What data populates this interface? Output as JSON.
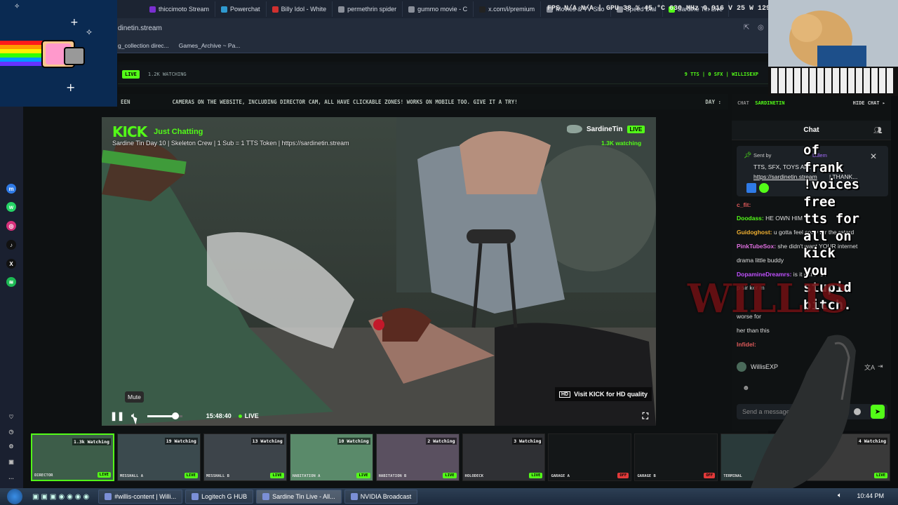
{
  "browser": {
    "tabs": [
      {
        "label": "thiccimoto Stream",
        "color": "#7a2fd0"
      },
      {
        "label": "Powerchat",
        "color": "#2f9ad0"
      },
      {
        "label": "Billy Idol - White",
        "color": "#d0302f"
      },
      {
        "label": "permethrin spider",
        "color": "#8a8f99"
      },
      {
        "label": "gummo movie - C",
        "color": "#8a8f99"
      },
      {
        "label": "x.com/i/premium",
        "color": "#222222"
      },
      {
        "label": "Movies & TV Sho",
        "color": "#8a8f99"
      },
      {
        "label": "Speed Dial",
        "color": "#8a8f99"
      },
      {
        "label": "Sardine Tin Live",
        "color": "#53fc18"
      }
    ],
    "perf_overlay": "FPS  N/A  N/A  |  GPU  38 %  45 °C  630 MHz  0.916 V  25 W  1298 RPM",
    "address": "dinetin.stream",
    "bookmarks": [
      "g_collection direc...",
      "Games_Archive ~ Pa..."
    ]
  },
  "site": {
    "top_live": "LIVE",
    "top_watching": "1.2K WATCHING",
    "top_right": "9 TTS | 0 SFX | WILLISEXP",
    "ticker_left": "EEN",
    "ticker": "CAMERAS ON THE WEBSITE, INCLUDING DIRECTOR CAM, ALL HAVE CLICKABLE ZONES! WORKS ON MOBILE TOO. GIVE IT A TRY!",
    "ticker_right": "DAY :"
  },
  "player": {
    "platform": "KICK",
    "category": "Just Chatting",
    "title": "Sardine Tin Day 10 | Skeleton Crew | 1 Sub = 1 TTS Token | https://sardinetin.stream",
    "channel": "SardineTin",
    "live_badge": "LIVE",
    "watching": "1.3K watching",
    "hd_label": "HD",
    "hd_text": "Visit KICK for HD quality",
    "time": "15:48:40",
    "live_label": "LIVE",
    "tooltip": "Mute",
    "volume": 0.8
  },
  "cameras": [
    {
      "watching": "1.3k Watching",
      "name": "DIRECTOR",
      "status": "LIVE",
      "active": true
    },
    {
      "watching": "19 Watching",
      "name": "MESSHALL A",
      "status": "LIVE"
    },
    {
      "watching": "13 Watching",
      "name": "MESSHALL B",
      "status": "LIVE"
    },
    {
      "watching": "10 Watching",
      "name": "HABITATION A",
      "status": "LIVE"
    },
    {
      "watching": "2 Watching",
      "name": "HABITATION B",
      "status": "LIVE"
    },
    {
      "watching": "3 Watching",
      "name": "HOLODECK",
      "status": "LIVE"
    },
    {
      "watching": "",
      "name": "GARAGE A",
      "status": "OFF"
    },
    {
      "watching": "",
      "name": "GARAGE B",
      "status": "OFF"
    },
    {
      "watching": "5 W",
      "name": "TERMINAL",
      "status": ""
    },
    {
      "watching": "4 Watching",
      "name": "",
      "status": "LIVE"
    }
  ],
  "chat": {
    "head_label": "CHAT",
    "head_channel": "SARDINETIN",
    "hide": "HIDE CHAT ▸",
    "title": "Chat",
    "pinned_sent_by": "Sent by",
    "pinned_user": "Dillem",
    "pinned_line1": "TTS, SFX, TOYS ALL B",
    "pinned_link": "https://sardinetin.stream",
    "pinned_tail": "| THANK...",
    "messages": [
      {
        "user": "c_fit:",
        "text": "",
        "color": "#e05a5a"
      },
      {
        "user": "Doodass:",
        "text": "HE OWN HIM",
        "color": "#53fc18"
      },
      {
        "user": "Guidoghost:",
        "text": "u gotta feel sorry for the retard",
        "color": "#f0b030"
      },
      {
        "user": "PinkTubeSox:",
        "text": "she didn't want YOUR internet",
        "color": "#e070e0"
      },
      {
        "user": "",
        "text": "drama little buddy",
        "color": "#ddd"
      },
      {
        "user": "DopamineDreamrs:",
        "text": "is it       ant to be",
        "color": "#c050ff"
      },
      {
        "user": "",
        "text": "p     sir   ker m",
        "color": "#ddd"
      },
      {
        "user": "",
        "text": "worse for",
        "color": "#ddd"
      },
      {
        "user": "",
        "text": "her than this",
        "color": "#ddd"
      },
      {
        "user": "Infidel:",
        "text": "",
        "color": "#e05a5a"
      }
    ],
    "current_user": "WillisEXP",
    "send_placeholder": "Send a message"
  },
  "overlay_text": [
    "of",
    "frank",
    "!voices",
    "free",
    "tts for",
    "all on",
    "kick",
    "you",
    "stupid",
    "bitch."
  ],
  "watermark": "WILLIS",
  "taskbar": {
    "items": [
      "#willis-content | Willi...",
      "Logitech G HUB",
      "Sardine Tin Live - All...",
      "NVIDIA Broadcast"
    ],
    "clock": "10:44 PM"
  }
}
